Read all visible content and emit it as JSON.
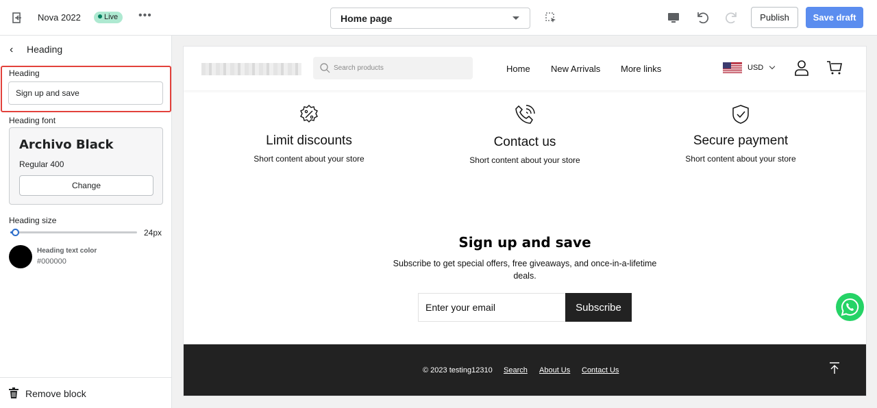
{
  "topbar": {
    "store_name": "Nova 2022",
    "live_badge": "Live",
    "more": "•••",
    "page_select": "Home page",
    "publish_label": "Publish",
    "save_label": "Save draft"
  },
  "sidebar": {
    "title": "Heading",
    "heading_label": "Heading",
    "heading_value": "Sign up and save",
    "font_label": "Heading font",
    "font_name": "Archivo Black",
    "font_weight": "Regular 400",
    "change_label": "Change",
    "size_label": "Heading size",
    "size_value": "24px",
    "size_fraction": 0.04,
    "color_title": "Heading text color",
    "color_value": "#000000",
    "remove_label": "Remove block"
  },
  "store": {
    "search_placeholder": "Search products",
    "nav": [
      "Home",
      "New Arrivals",
      "More links"
    ],
    "currency": "USD",
    "features": [
      {
        "icon": "discount-icon",
        "title": "Limit discounts",
        "text": "Short content about your store"
      },
      {
        "icon": "phone-icon",
        "title": "Contact us",
        "text": "Short content about your store"
      },
      {
        "icon": "shield-check-icon",
        "title": "Secure payment",
        "text": "Short content about your store"
      }
    ],
    "signup": {
      "title": "Sign up and save",
      "text": "Subscribe to get special offers, free giveaways, and once-in-a-lifetime deals.",
      "email_placeholder": "Enter your email",
      "button": "Subscribe"
    },
    "footer": {
      "copyright": "© 2023 testing12310",
      "links": [
        "Search",
        "About Us",
        "Contact Us"
      ]
    }
  },
  "colors": {
    "accent": "#5b8def",
    "highlight": "#e2413b",
    "footer_bg": "#222222",
    "whatsapp": "#25d366"
  }
}
